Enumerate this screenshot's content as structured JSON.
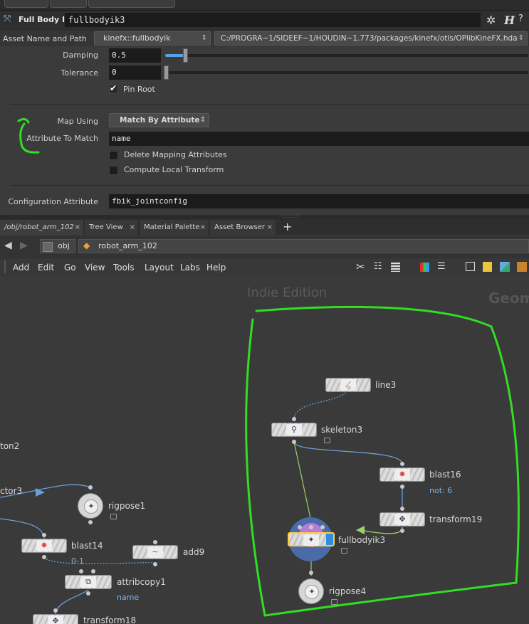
{
  "colors": {
    "accent_green": "#33dd22",
    "wire_blue": "#6a9fd8",
    "select_yellow": "#ffcc44"
  },
  "param_header": {
    "node_type": "Full Body IK",
    "node_name": "fullbodyik3",
    "icons": [
      "gear-icon",
      "help-icon"
    ]
  },
  "asset": {
    "label": "Asset Name and Path",
    "name": "kinefx::fullbodyik",
    "path": "C:/PROGRA~1/SIDEEF~1/HOUDIN~1.773/packages/kinefx/otls/OPlibKineFX.hda"
  },
  "params": {
    "damping": {
      "label": "Damping",
      "value": "0.5",
      "level": 0.26
    },
    "tolerance": {
      "label": "Tolerance",
      "value": "0",
      "level": 0.0
    },
    "pin_root": {
      "label": "Pin Root",
      "checked": true
    },
    "map_using": {
      "label": "Map Using",
      "value": "Match By Attribute"
    },
    "attribute_to_match": {
      "label": "Attribute To Match",
      "value": "name"
    },
    "delete_mapping": {
      "label": "Delete Mapping Attributes",
      "checked": false
    },
    "compute_local": {
      "label": "Compute Local Transform",
      "checked": false
    },
    "config_attribute": {
      "label": "Configuration Attribute",
      "value": "fbik_jointconfig"
    }
  },
  "tabs": [
    {
      "label": "/obj/robot_arm_102",
      "active": true
    },
    {
      "label": "Tree View"
    },
    {
      "label": "Material Palette"
    },
    {
      "label": "Asset Browser"
    }
  ],
  "add_tab": "+",
  "path": {
    "root": "obj",
    "current": "robot_arm_102"
  },
  "menu": [
    "Add",
    "Edit",
    "Go",
    "View",
    "Tools",
    "Layout",
    "Labs",
    "Help"
  ],
  "network": {
    "watermark": "Indie Edition",
    "context_label": "Geom",
    "nodes": {
      "line3": "line3",
      "skeleton3": "skeleton3",
      "blast16": "blast16",
      "blast16_sub": "not: 6",
      "transform19": "transform19",
      "fullbodyik3": "fullbodyik3",
      "rigpose4": "rigpose4",
      "rigpose1": "rigpose1",
      "blast14": "blast14",
      "blast14_sub": "0-1",
      "add9": "add9",
      "attribcopy1": "attribcopy1",
      "attribcopy1_sub": "name",
      "transform18": "transform18",
      "skeleton2_partial": "ton2",
      "vector3_partial": "ctor3"
    }
  }
}
